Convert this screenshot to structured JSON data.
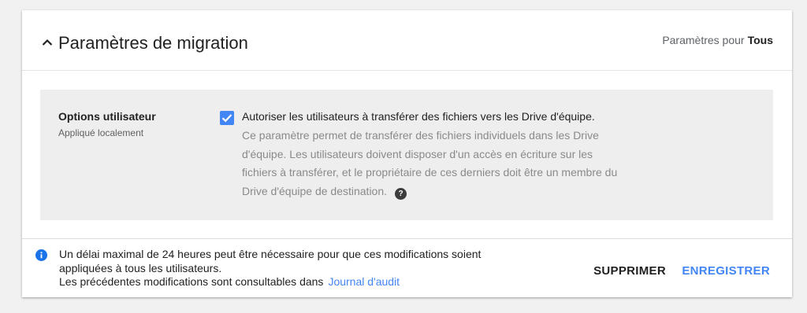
{
  "header": {
    "title": "Paramètres de migration",
    "settings_for_label": "Paramètres pour",
    "settings_for_scope": "Tous"
  },
  "user_options": {
    "title": "Options utilisateur",
    "subtitle": "Appliqué localement",
    "checkbox": {
      "checked": true,
      "label": "Autoriser les utilisateurs à transférer des fichiers vers les Drive d'équipe.",
      "description_lines": [
        "Ce paramètre permet de transférer des fichiers individuels dans les Drive",
        "d'équipe. Les utilisateurs doivent disposer d'un accès en écriture sur les",
        "fichiers à transférer, et le propriétaire de ces derniers doit être un membre du",
        "Drive d'équipe de destination."
      ]
    }
  },
  "footer": {
    "notice_lines": [
      "Un délai maximal de 24 heures peut être nécessaire pour que ces modifications soient",
      "appliquées à tous les utilisateurs.",
      "Les précédentes modifications sont consultables dans"
    ],
    "audit_link": "Journal d'audit",
    "delete_label": "SUPPRIMER",
    "save_label": "ENREGISTRER"
  },
  "icons": {
    "collapse": "chevron-up-icon",
    "help": "help-circle-icon",
    "info": "info-icon",
    "checkmark": "check-icon"
  },
  "colors": {
    "accent": "#4285f4",
    "section_bg": "#eeeeee",
    "page_bg": "#f1f1f1"
  }
}
